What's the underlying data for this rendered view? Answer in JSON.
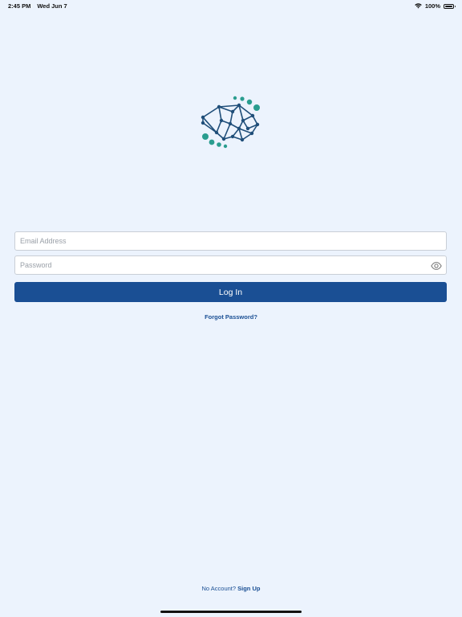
{
  "status_bar": {
    "time": "2:45 PM",
    "date": "Wed Jun 7",
    "battery_percent": "100%"
  },
  "logo": {
    "icon": "brain-network-logo",
    "primary_color": "#1f4e79",
    "accent_color": "#2a9d8f"
  },
  "form": {
    "email_placeholder": "Email Address",
    "email_value": "",
    "password_placeholder": "Password",
    "password_value": "",
    "login_label": "Log In",
    "forgot_label": "Forgot Password?"
  },
  "footer": {
    "prompt": "No Account?",
    "signup_label": "Sign Up"
  },
  "colors": {
    "background": "#ecf3fd",
    "button": "#1a4f94",
    "link": "#1a4f94"
  }
}
